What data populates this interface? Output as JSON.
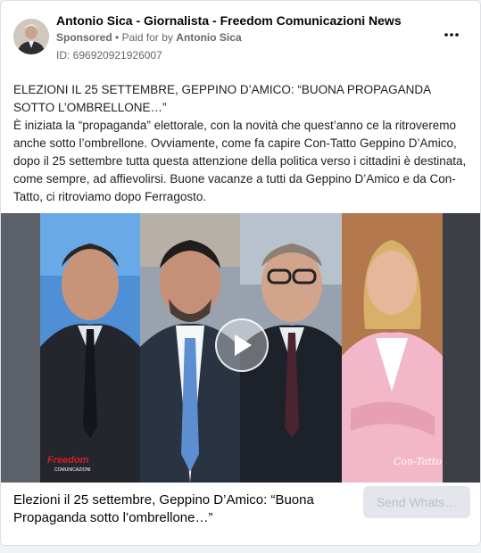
{
  "header": {
    "page_name": "Antonio Sica - Giornalista - Freedom Comunicazioni News",
    "sponsored_label": "Sponsored",
    "separator": "•",
    "paid_for_label": "Paid for by",
    "paid_for_name": "Antonio Sica",
    "ad_id": "ID: 696920921926007",
    "more_icon": "more-horizontal-icon"
  },
  "post": {
    "title_line": "ELEZIONI IL 25 SETTEMBRE, GEPPINO D’AMICO: “BUONA PROPAGANDA SOTTO L’OMBRELLONE…”",
    "body": "È iniziata la “propaganda” elettorale, con la novità che quest’anno ce la ritroveremo anche sotto l’ombrellone. Ovviamente, come fa capire Con-Tatto Geppino D’Amico, dopo il 25 settembre tutta questa attenzione della politica verso i cittadini è destinata, come sempre, ad affievolirsi. Buone vacanze a tutti da Geppino D’Amico e da Con-Tatto, ci ritroviamo dopo Ferragosto."
  },
  "media": {
    "watermark_left": "Freedom",
    "watermark_left_sub": "COMUNICAZIONI",
    "watermark_right": "Con-Tatto",
    "play_icon": "play-icon"
  },
  "footer": {
    "headline": "Elezioni il 25 settembre, Geppino D’Amico: “Buona Propaganda sotto l’ombrellone…”",
    "cta_label": "Send Whats…"
  },
  "colors": {
    "text_primary": "#050505",
    "text_secondary": "#65676b",
    "cta_bg": "#e4e6eb",
    "cta_text": "#bcc0c4",
    "freedom_red": "#d0202a"
  }
}
